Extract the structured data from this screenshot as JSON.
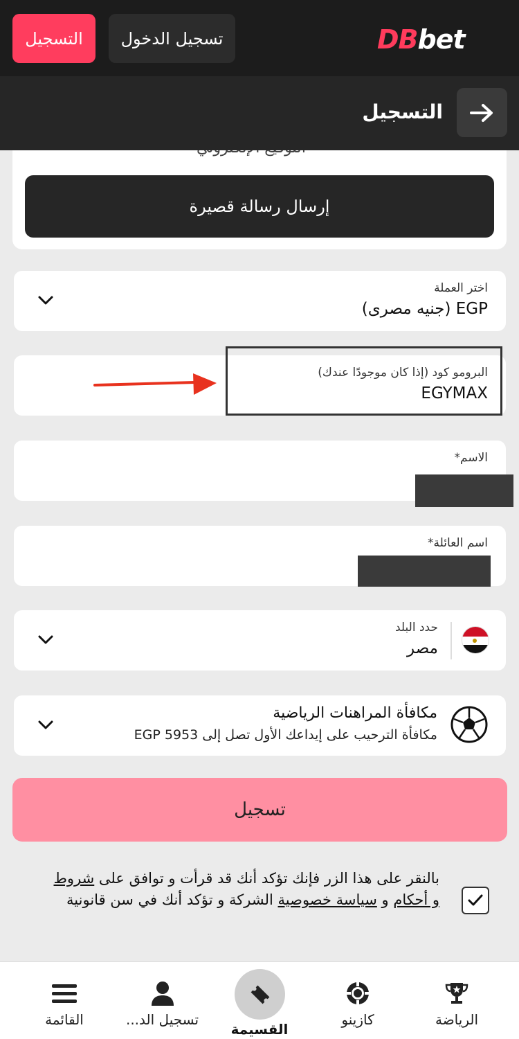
{
  "header": {
    "logo_part1": "DB",
    "logo_part2": "bet",
    "login_label": "تسجيل الدخول",
    "register_label": "التسجيل"
  },
  "titlebar": {
    "title": "التسجيل"
  },
  "top_card": {
    "partial_text": "التوقيع الإلكتروني",
    "sms_button": "إرسال رسالة قصيرة"
  },
  "currency": {
    "label": "اختر العملة",
    "value": "EGP  (جنيه مصرى)"
  },
  "promo": {
    "label": "البرومو كود (إذا كان موجودًا عندك)",
    "value": "EGYMAX"
  },
  "first_name": {
    "label": "الاسم*"
  },
  "last_name": {
    "label": "اسم العائلة*"
  },
  "country": {
    "label": "حدد البلد",
    "value": "مصر"
  },
  "bonus": {
    "title": "مكافأة المراهنات الرياضية",
    "subtitle": "مكافأة الترحيب على إيداعك الأول تصل إلى EGP 5953"
  },
  "submit_label": "تسجيل",
  "terms": {
    "part1": "بالنقر على هذا الزر فإنك تؤكد أنك قد قرأت و توافق على ",
    "link1": "شروط و أحكام",
    "mid": " و ",
    "link2": "سياسة خصوصية",
    "part2": " الشركة و تؤكد أنك في سن قانونية",
    "checked": true
  },
  "bottom_nav": {
    "sports": "الرياضة",
    "casino": "كازينو",
    "coupon": "القسيمة",
    "login": "تسجيل الد...",
    "menu": "القائمة"
  },
  "colors": {
    "brand_red": "#ff3d5e",
    "submit_pink": "#ff8fa2",
    "dark": "#1c1c1c",
    "arrow_red": "#e8321e"
  }
}
